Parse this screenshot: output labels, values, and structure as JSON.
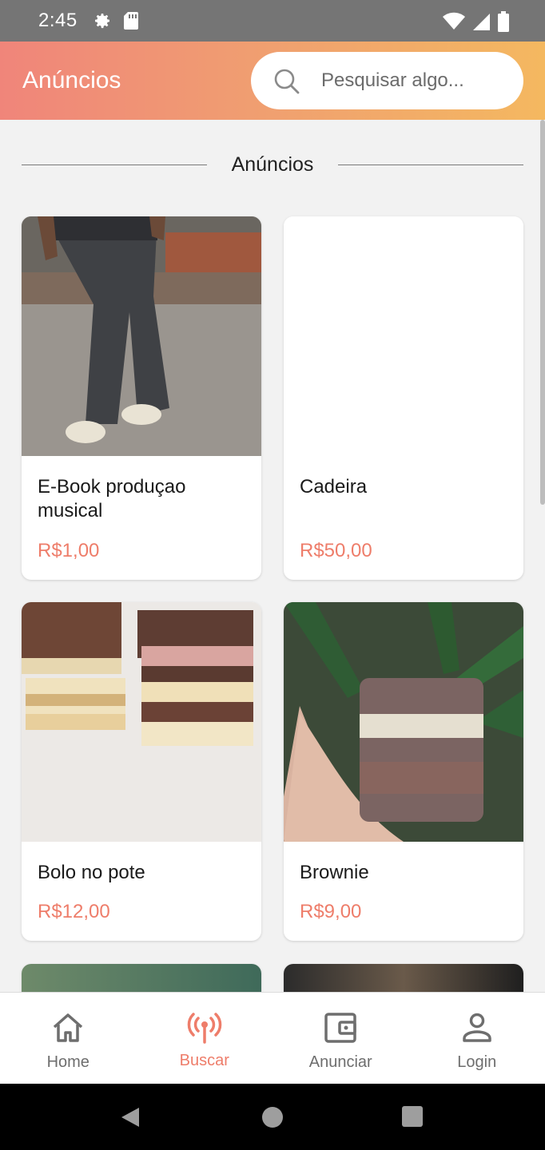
{
  "status_bar": {
    "time": "2:45"
  },
  "app_bar": {
    "title": "Anúncios",
    "search_placeholder": "Pesquisar algo..."
  },
  "section": {
    "title": "Anúncios"
  },
  "ads": [
    {
      "title": "E-Book produçao musical",
      "price": "R$1,00"
    },
    {
      "title": "Cadeira",
      "price": "R$50,00"
    },
    {
      "title": "Bolo no pote",
      "price": "R$12,00"
    },
    {
      "title": "Brownie",
      "price": "R$9,00"
    }
  ],
  "bottom_nav": [
    {
      "label": "Home",
      "icon": "home-icon"
    },
    {
      "label": "Buscar",
      "icon": "broadcast-icon",
      "active": true
    },
    {
      "label": "Anunciar",
      "icon": "wallet-icon"
    },
    {
      "label": "Login",
      "icon": "person-icon"
    }
  ],
  "colors": {
    "accent": "#ee7d6a",
    "gradient_start": "#f0857a",
    "gradient_end": "#f4b860"
  }
}
